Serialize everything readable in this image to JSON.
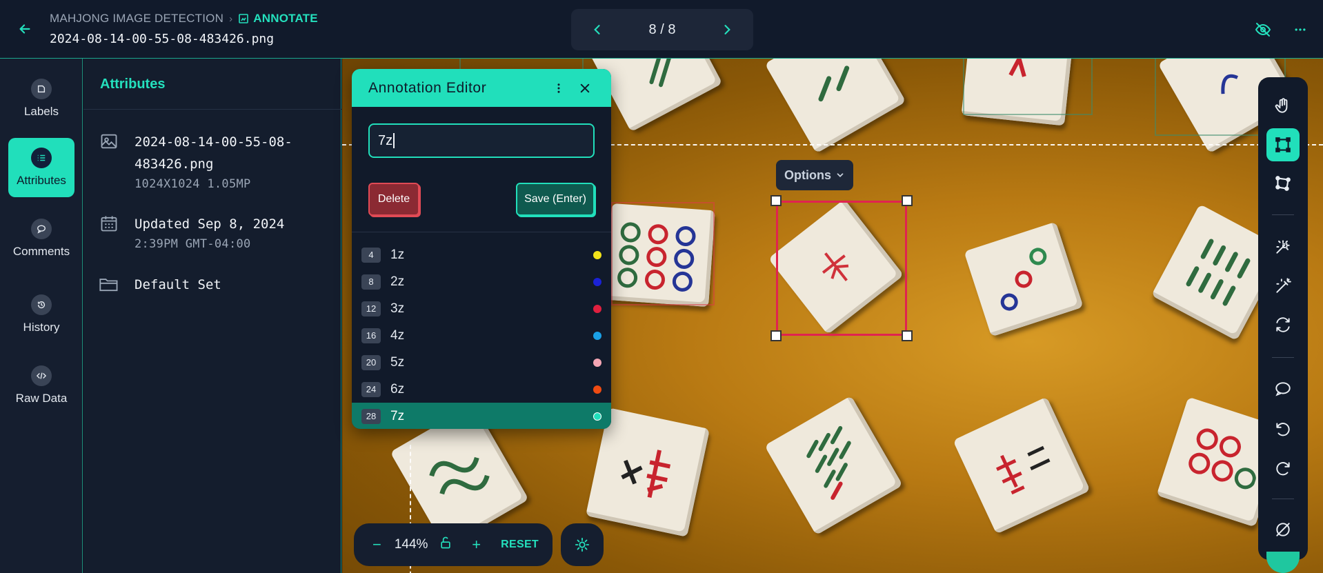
{
  "header": {
    "breadcrumb_project": "MAHJONG IMAGE DETECTION",
    "breadcrumb_mode": "ANNOTATE",
    "filename": "2024-08-14-00-55-08-483426.png",
    "pager": "8 / 8",
    "icons": [
      "arrow-left-icon",
      "annotate-icon",
      "chevron-left-icon",
      "chevron-right-icon",
      "eye-off-icon",
      "more-icon"
    ]
  },
  "rail": {
    "items": [
      {
        "label": "Labels",
        "icon": "tag-icon"
      },
      {
        "label": "Attributes",
        "icon": "list-icon",
        "active": true
      },
      {
        "label": "Comments",
        "icon": "comment-icon"
      },
      {
        "label": "History",
        "icon": "history-icon"
      },
      {
        "label": "Raw Data",
        "icon": "code-icon"
      }
    ]
  },
  "attributes": {
    "title": "Attributes",
    "file_line1": "2024-08-14-00-55-08-",
    "file_line2": "483426.png",
    "file_meta": "1024X1024  1.05MP",
    "updated": "Updated Sep 8, 2024",
    "updated_time": "2:39PM  GMT-04:00",
    "set": "Default Set"
  },
  "editor": {
    "title": "Annotation Editor",
    "input_value": "7z",
    "delete_label": "Delete",
    "save_label": "Save (Enter)",
    "labels": [
      {
        "key": "4",
        "name": "1z",
        "color": "#f2e21a"
      },
      {
        "key": "8",
        "name": "2z",
        "color": "#1b22d6"
      },
      {
        "key": "12",
        "name": "3z",
        "color": "#e0203f"
      },
      {
        "key": "16",
        "name": "4z",
        "color": "#1aa0e6"
      },
      {
        "key": "20",
        "name": "5z",
        "color": "#f5a6b4"
      },
      {
        "key": "24",
        "name": "6z",
        "color": "#ef4b12"
      },
      {
        "key": "28",
        "name": "7z",
        "color": "#21dfbb",
        "selected": true
      }
    ]
  },
  "canvas": {
    "options_label": "Options"
  },
  "zoom": {
    "minus": "−",
    "value": "144%",
    "plus": "+",
    "reset": "RESET"
  },
  "toolbar": {
    "tools": [
      "pan-hand-icon",
      "bounding-box-icon",
      "polygon-icon",
      "magic-select-icon",
      "magic-wand-icon",
      "sync-icon",
      "comment-icon",
      "undo-icon",
      "redo-icon",
      "hide-annotations-icon"
    ],
    "active": "bounding-box-icon"
  }
}
